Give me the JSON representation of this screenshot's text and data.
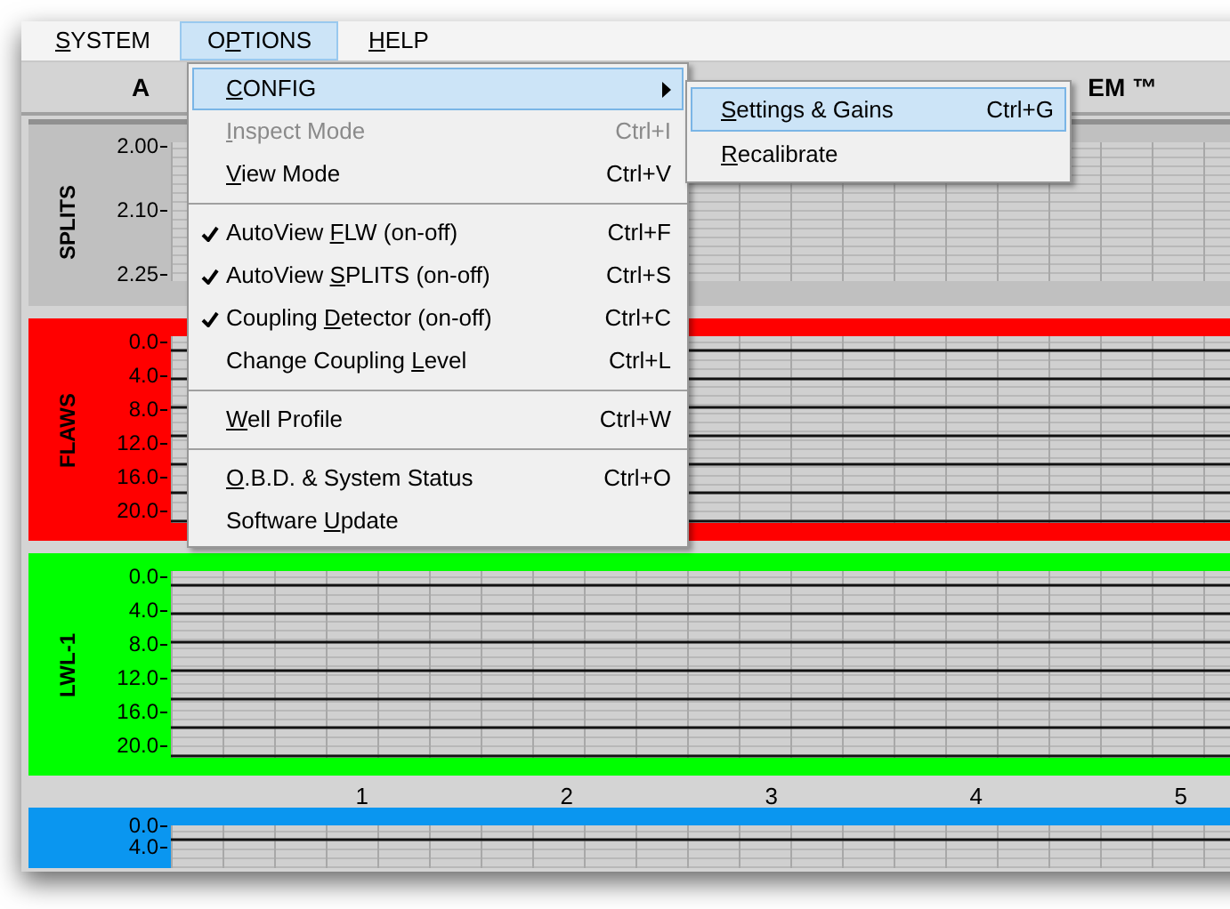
{
  "menu_bar": [
    {
      "key": "S",
      "post": "YSTEM",
      "selected": false
    },
    {
      "pre": "O",
      "key": "P",
      "post": "TIONS",
      "selected": true
    },
    {
      "key": "H",
      "post": "ELP",
      "selected": false
    }
  ],
  "title_parts": [
    "A",
    "EM ™"
  ],
  "menu": [
    {
      "kind": "item",
      "key": "C",
      "post": "ONFIG",
      "checked": false,
      "disabled": false,
      "submenu": true,
      "selected": true
    },
    {
      "kind": "item",
      "key": "I",
      "post": "nspect Mode",
      "shortcut": "Ctrl+I",
      "checked": false,
      "disabled": true,
      "submenu": false,
      "selected": false
    },
    {
      "kind": "item",
      "key": "V",
      "post": "iew Mode",
      "shortcut": "Ctrl+V",
      "checked": false,
      "disabled": false,
      "submenu": false,
      "selected": false
    },
    {
      "kind": "separator"
    },
    {
      "kind": "item",
      "pre": "AutoView ",
      "key": "F",
      "post": "LW (on-off)",
      "shortcut": "Ctrl+F",
      "checked": true,
      "disabled": false,
      "submenu": false,
      "selected": false
    },
    {
      "kind": "item",
      "pre": "AutoView ",
      "key": "S",
      "post": "PLITS (on-off)",
      "shortcut": "Ctrl+S",
      "checked": true,
      "disabled": false,
      "submenu": false,
      "selected": false
    },
    {
      "kind": "item",
      "pre": "Coupling ",
      "key": "D",
      "post": "etector (on-off)",
      "shortcut": "Ctrl+C",
      "checked": true,
      "disabled": false,
      "submenu": false,
      "selected": false
    },
    {
      "kind": "item",
      "pre": "Change Coupling ",
      "key": "L",
      "post": "evel",
      "shortcut": "Ctrl+L",
      "checked": false,
      "disabled": false,
      "submenu": false,
      "selected": false
    },
    {
      "kind": "separator"
    },
    {
      "kind": "item",
      "key": "W",
      "post": "ell Profile",
      "shortcut": "Ctrl+W",
      "checked": false,
      "disabled": false,
      "submenu": false,
      "selected": false
    },
    {
      "kind": "separator"
    },
    {
      "kind": "item",
      "key": "O",
      "post": ".B.D. & System Status",
      "shortcut": "Ctrl+O",
      "checked": false,
      "disabled": false,
      "submenu": false,
      "selected": false
    },
    {
      "kind": "item",
      "pre": "Software ",
      "key": "U",
      "post": "pdate",
      "checked": false,
      "disabled": false,
      "submenu": false,
      "selected": false
    }
  ],
  "submenu": [
    {
      "key": "S",
      "post": "ettings & Gains",
      "shortcut": "Ctrl+G",
      "selected": true
    },
    {
      "key": "R",
      "post": "ecalibrate",
      "selected": false
    }
  ],
  "panels": [
    {
      "kind": "splits",
      "label": "SPLITS",
      "color": "#c0c0c0",
      "ticks": [
        "2.00",
        "2.10",
        "2.25"
      ]
    },
    {
      "kind": "trace",
      "label": "FLAWS",
      "color": "#ff0000",
      "ticks": [
        "0.0",
        "4.0",
        "8.0",
        "12.0",
        "16.0",
        "20.0"
      ]
    },
    {
      "kind": "trace",
      "label": "LWL-1",
      "color": "#00ff00",
      "ticks": [
        "0.0",
        "4.0",
        "8.0",
        "12.0",
        "16.0",
        "20.0"
      ]
    },
    {
      "kind": "axis",
      "ticks": [
        "1",
        "2",
        "3",
        "4",
        "5"
      ]
    },
    {
      "kind": "partial",
      "color": "#0a96f0",
      "ticks": [
        "0.0",
        "4.0"
      ]
    }
  ]
}
